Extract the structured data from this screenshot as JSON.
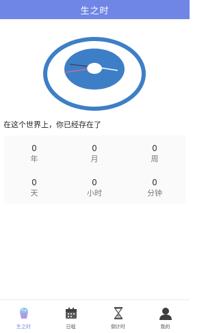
{
  "header": {
    "title": "生之时"
  },
  "main": {
    "headline": "在这个世界上，你已经存在了",
    "stats": [
      {
        "value": "0",
        "unit": "年"
      },
      {
        "value": "0",
        "unit": "月"
      },
      {
        "value": "0",
        "unit": "周"
      },
      {
        "value": "0",
        "unit": "天"
      },
      {
        "value": "0",
        "unit": "小时"
      },
      {
        "value": "0",
        "unit": "分钟"
      }
    ]
  },
  "tabbar": {
    "tabs": [
      {
        "label": "生之时",
        "icon": "cupcake-icon",
        "active": true
      },
      {
        "label": "日程",
        "icon": "calendar-icon",
        "active": false
      },
      {
        "label": "倒计时",
        "icon": "hourglass-icon",
        "active": false
      },
      {
        "label": "我的",
        "icon": "user-icon",
        "active": false
      }
    ]
  },
  "colors": {
    "header_bg": "#6f86e6",
    "clock_blue": "#3d7fc6",
    "hand_pink": "#e06a8a",
    "active_tab": "#6f86e6"
  }
}
